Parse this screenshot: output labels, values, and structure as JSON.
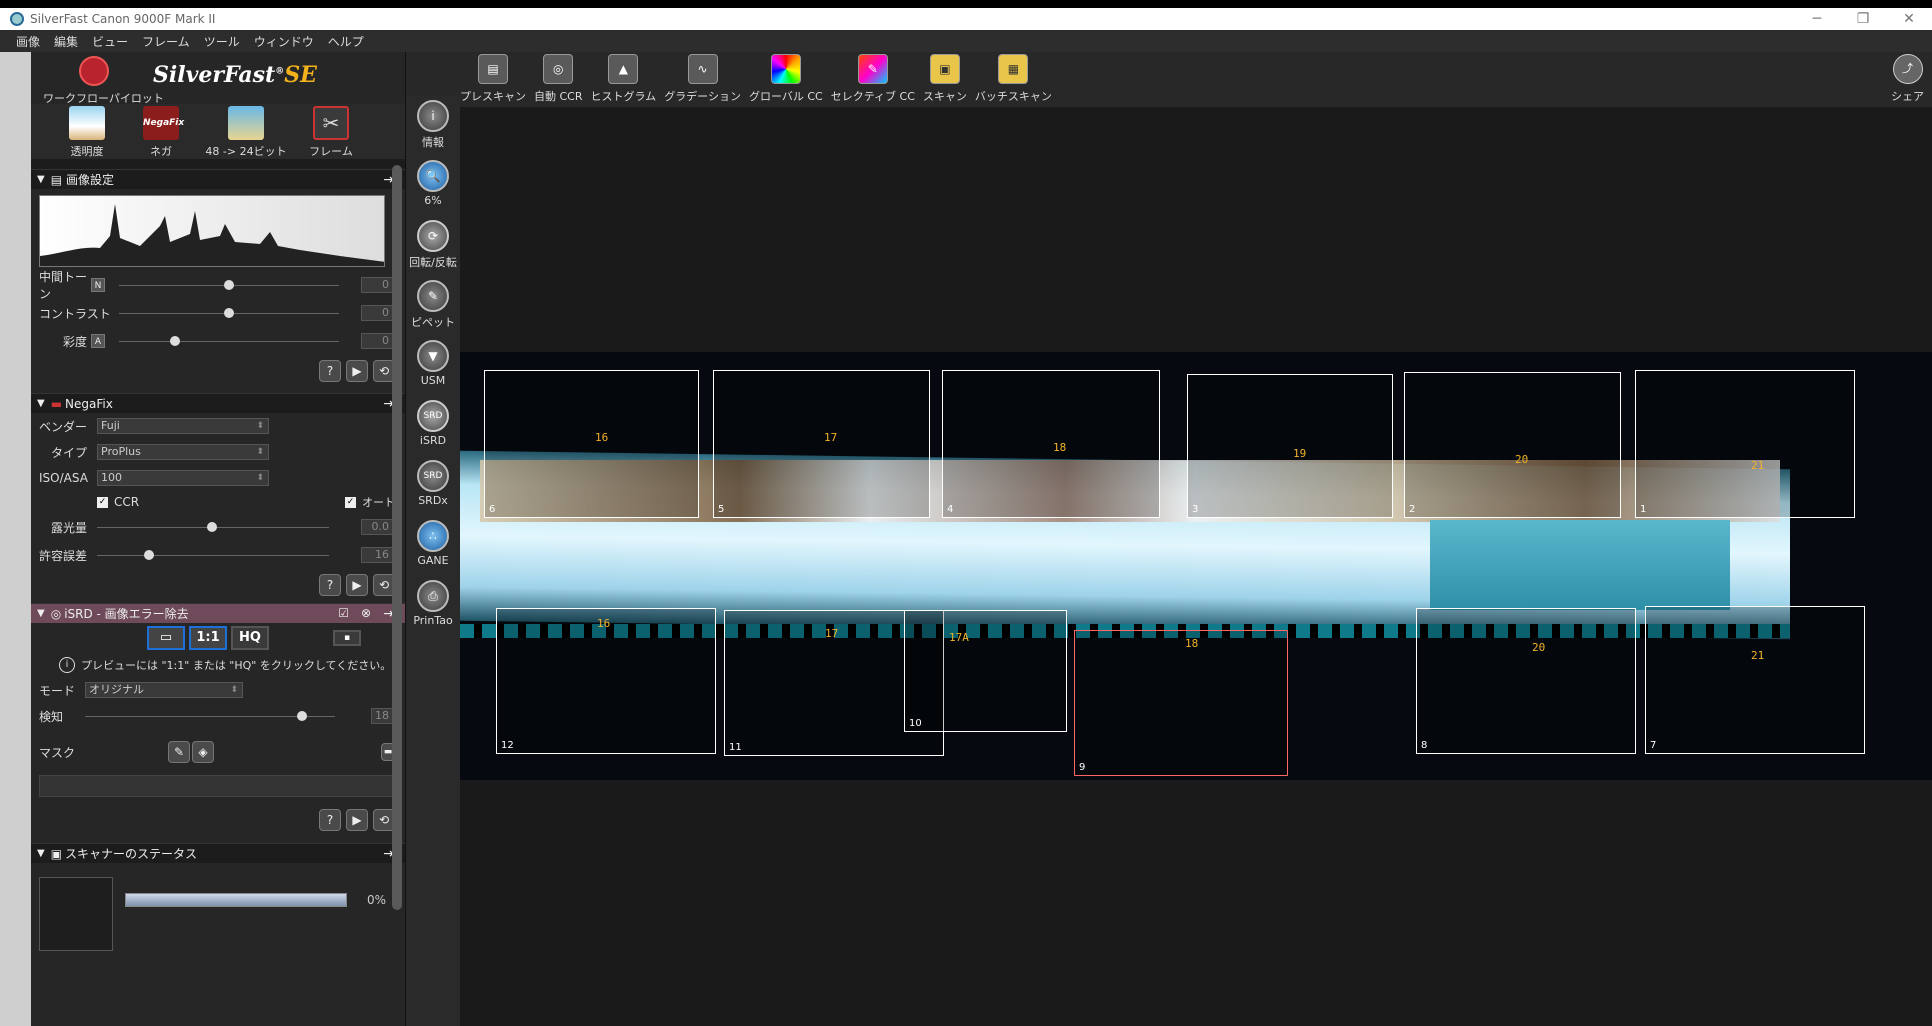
{
  "window": {
    "title": "SilverFast Canon 9000F Mark II",
    "minimize": "─",
    "maximize": "❐",
    "close": "✕"
  },
  "menu": [
    "画像",
    "編集",
    "ビュー",
    "フレーム",
    "ツール",
    "ウィンドウ",
    "ヘルプ"
  ],
  "sidebar": {
    "workflow_label": "ワークフローパイロット",
    "brand": "SilverFast",
    "brand_reg": "®",
    "brand_se": "SE",
    "quick": [
      {
        "label": "透明度",
        "icon": "transparency-icon"
      },
      {
        "label": "ネガ",
        "icon": "negafix-icon",
        "icon_text": "NegaFix"
      },
      {
        "label": "48 -> 24ビット",
        "icon": "bitdepth-icon"
      },
      {
        "label": "フレーム",
        "icon": "frame-tool-icon"
      }
    ],
    "image_settings": {
      "title": "画像設定",
      "midtone_label": "中間トーン",
      "midtone_badge": "N",
      "midtone_value": "0",
      "contrast_label": "コントラスト",
      "contrast_value": "0",
      "saturation_label": "彩度",
      "saturation_badge": "A",
      "saturation_value": "0"
    },
    "negafix": {
      "title": "NegaFix",
      "vendor_label": "ベンダー",
      "vendor_value": "Fuji",
      "type_label": "タイプ",
      "type_value": "ProPlus",
      "iso_label": "ISO/ASA",
      "iso_value": "100",
      "ccr_label": "CCR",
      "auto_label": "オート",
      "exposure_label": "露光量",
      "exposure_value": "0.0",
      "tolerance_label": "許容誤差",
      "tolerance_value": "16"
    },
    "isrd": {
      "title": "iSRD - 画像エラー除去",
      "btn_11": "1:1",
      "btn_hq": "HQ",
      "hint": "プレビューには \"1:1\" または \"HQ\" をクリックしてください。",
      "mode_label": "モード",
      "mode_value": "オリジナル",
      "detect_label": "検知",
      "detect_value": "18",
      "mask_label": "マスク"
    },
    "scanner_status": {
      "title": "スキャナーのステータス",
      "percent": "0%",
      "progress": 0.0
    }
  },
  "vtools": [
    {
      "label": "情報",
      "icon": "info-icon",
      "glyph": "i"
    },
    {
      "label": "6%",
      "icon": "zoom-icon",
      "glyph": "🔍"
    },
    {
      "label": "回転/反転",
      "icon": "rotate-icon",
      "glyph": "⟳"
    },
    {
      "label": "ピペット",
      "icon": "pipette-icon",
      "glyph": "✎"
    },
    {
      "label": "USM",
      "icon": "usm-icon",
      "glyph": "▼"
    },
    {
      "label": "iSRD",
      "icon": "isrd-icon",
      "glyph": "SRD"
    },
    {
      "label": "SRDx",
      "icon": "srdx-icon",
      "glyph": "SRD"
    },
    {
      "label": "GANE",
      "icon": "gane-icon",
      "glyph": "∴"
    },
    {
      "label": "PrinTao",
      "icon": "printao-icon",
      "glyph": "⎙"
    }
  ],
  "toolbar": [
    {
      "label": "プレスキャン",
      "icon": "prescan-icon",
      "glyph": "▤"
    },
    {
      "label": "自動 CCR",
      "icon": "auto-ccr-icon",
      "glyph": "◎"
    },
    {
      "label": "ヒストグラム",
      "icon": "histogram-icon",
      "glyph": "▲"
    },
    {
      "label": "グラデーション",
      "icon": "gradation-icon",
      "glyph": "∿"
    },
    {
      "label": "グローバル CC",
      "icon": "global-cc-icon",
      "glyph": ""
    },
    {
      "label": "セレクティブ CC",
      "icon": "selective-cc-icon",
      "glyph": "✎"
    },
    {
      "label": "スキャン",
      "icon": "scan-icon",
      "glyph": "▣"
    },
    {
      "label": "バッチスキャン",
      "icon": "batch-scan-icon",
      "glyph": "▦"
    }
  ],
  "share_label": "シェア",
  "frames_top": [
    {
      "num": "6",
      "code": "16"
    },
    {
      "num": "5",
      "code": "17"
    },
    {
      "num": "4",
      "code": "18"
    },
    {
      "num": "3",
      "code": "19"
    },
    {
      "num": "2",
      "code": "20"
    },
    {
      "num": "1",
      "code": "21"
    }
  ],
  "frames_bottom": [
    {
      "num": "12",
      "code": "16"
    },
    {
      "num": "11",
      "code": "17"
    },
    {
      "num": "10",
      "code": "17A"
    },
    {
      "num": "9",
      "code": "18"
    },
    {
      "num": "8",
      "code": "20"
    },
    {
      "num": "7",
      "code": "21"
    }
  ]
}
